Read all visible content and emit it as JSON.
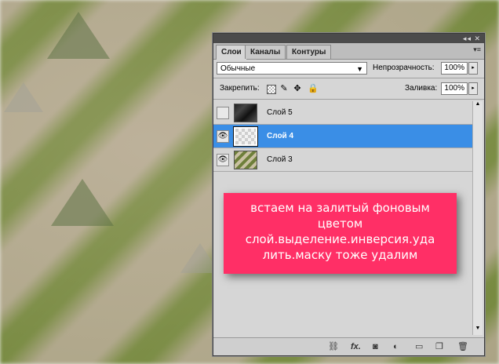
{
  "panel": {
    "tabs": [
      "Слои",
      "Каналы",
      "Контуры"
    ],
    "active_tab": "Слои",
    "blend_mode": "Обычные",
    "opacity_label": "Непрозрачность:",
    "opacity_value": "100%",
    "lock_label": "Закрепить:",
    "fill_label": "Заливка:",
    "fill_value": "100%",
    "layers": [
      {
        "name": "Слой 5",
        "visible": false,
        "selected": false
      },
      {
        "name": "Слой 4",
        "visible": true,
        "selected": true
      },
      {
        "name": "Слой 3",
        "visible": true,
        "selected": false
      }
    ],
    "bottom_icons": [
      "link-icon",
      "fx-icon",
      "mask-icon",
      "adjustment-icon",
      "folder-icon",
      "new-layer-icon",
      "trash-icon"
    ],
    "accent_color": "#3a8ee6"
  },
  "note": {
    "line1": "встаем на залитый фоновым",
    "line2": "цветом",
    "line3": "слой.выделение.инверсия.уда",
    "line4": "лить.маску тоже удалим",
    "bg_color": "#ff2f66"
  }
}
